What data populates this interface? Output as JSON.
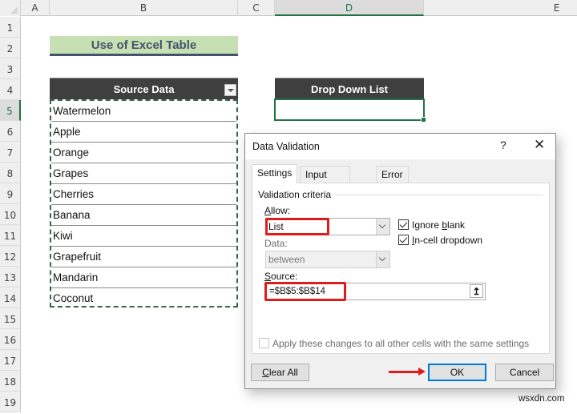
{
  "spreadsheet": {
    "columns": [
      "A",
      "B",
      "C",
      "D",
      "E"
    ],
    "active_column": "D",
    "rows": [
      "1",
      "2",
      "3",
      "4",
      "5",
      "6",
      "7",
      "8",
      "9",
      "10",
      "11",
      "12",
      "13",
      "14",
      "15",
      "16",
      "17",
      "18",
      "19"
    ],
    "active_row": "5",
    "title": "Use of Excel Table",
    "source_table": {
      "header": "Source Data",
      "items": [
        "Watermelon",
        "Apple",
        "Orange",
        "Grapes",
        "Cherries",
        "Banana",
        "Kiwi",
        "Grapefruit",
        "Mandarin",
        "Coconut"
      ]
    },
    "dropdown_table": {
      "header": "Drop Down List",
      "value": ""
    }
  },
  "dialog": {
    "title": "Data Validation",
    "help": "?",
    "close": "✕",
    "tabs": [
      "Settings",
      "Input Message",
      "Error Alert"
    ],
    "active_tab": "Settings",
    "group_label": "Validation criteria",
    "allow": {
      "label_prefix": "",
      "label_underlined": "A",
      "label_rest": "llow:",
      "value": "List"
    },
    "data": {
      "label": "Data:",
      "value": "between"
    },
    "ignore_blank": {
      "label_pre": "Ignore ",
      "label_u": "b",
      "label_post": "lank",
      "checked": true
    },
    "incell_dropdown": {
      "label_u": "I",
      "label_post": "n-cell dropdown",
      "checked": true
    },
    "source": {
      "label_u": "S",
      "label_post": "ource:",
      "value": "=$B$5:$B$14",
      "ref_icon": "↥"
    },
    "apply_all": {
      "label": "Apply these changes to all other cells with the same settings",
      "checked": false
    },
    "buttons": {
      "clear_all_u": "C",
      "clear_all_rest": "lear All",
      "ok": "OK",
      "cancel": "Cancel"
    },
    "highlight_color": "#e01b1b",
    "accent_color": "#0078d7"
  },
  "watermark": "wsxdn.com"
}
